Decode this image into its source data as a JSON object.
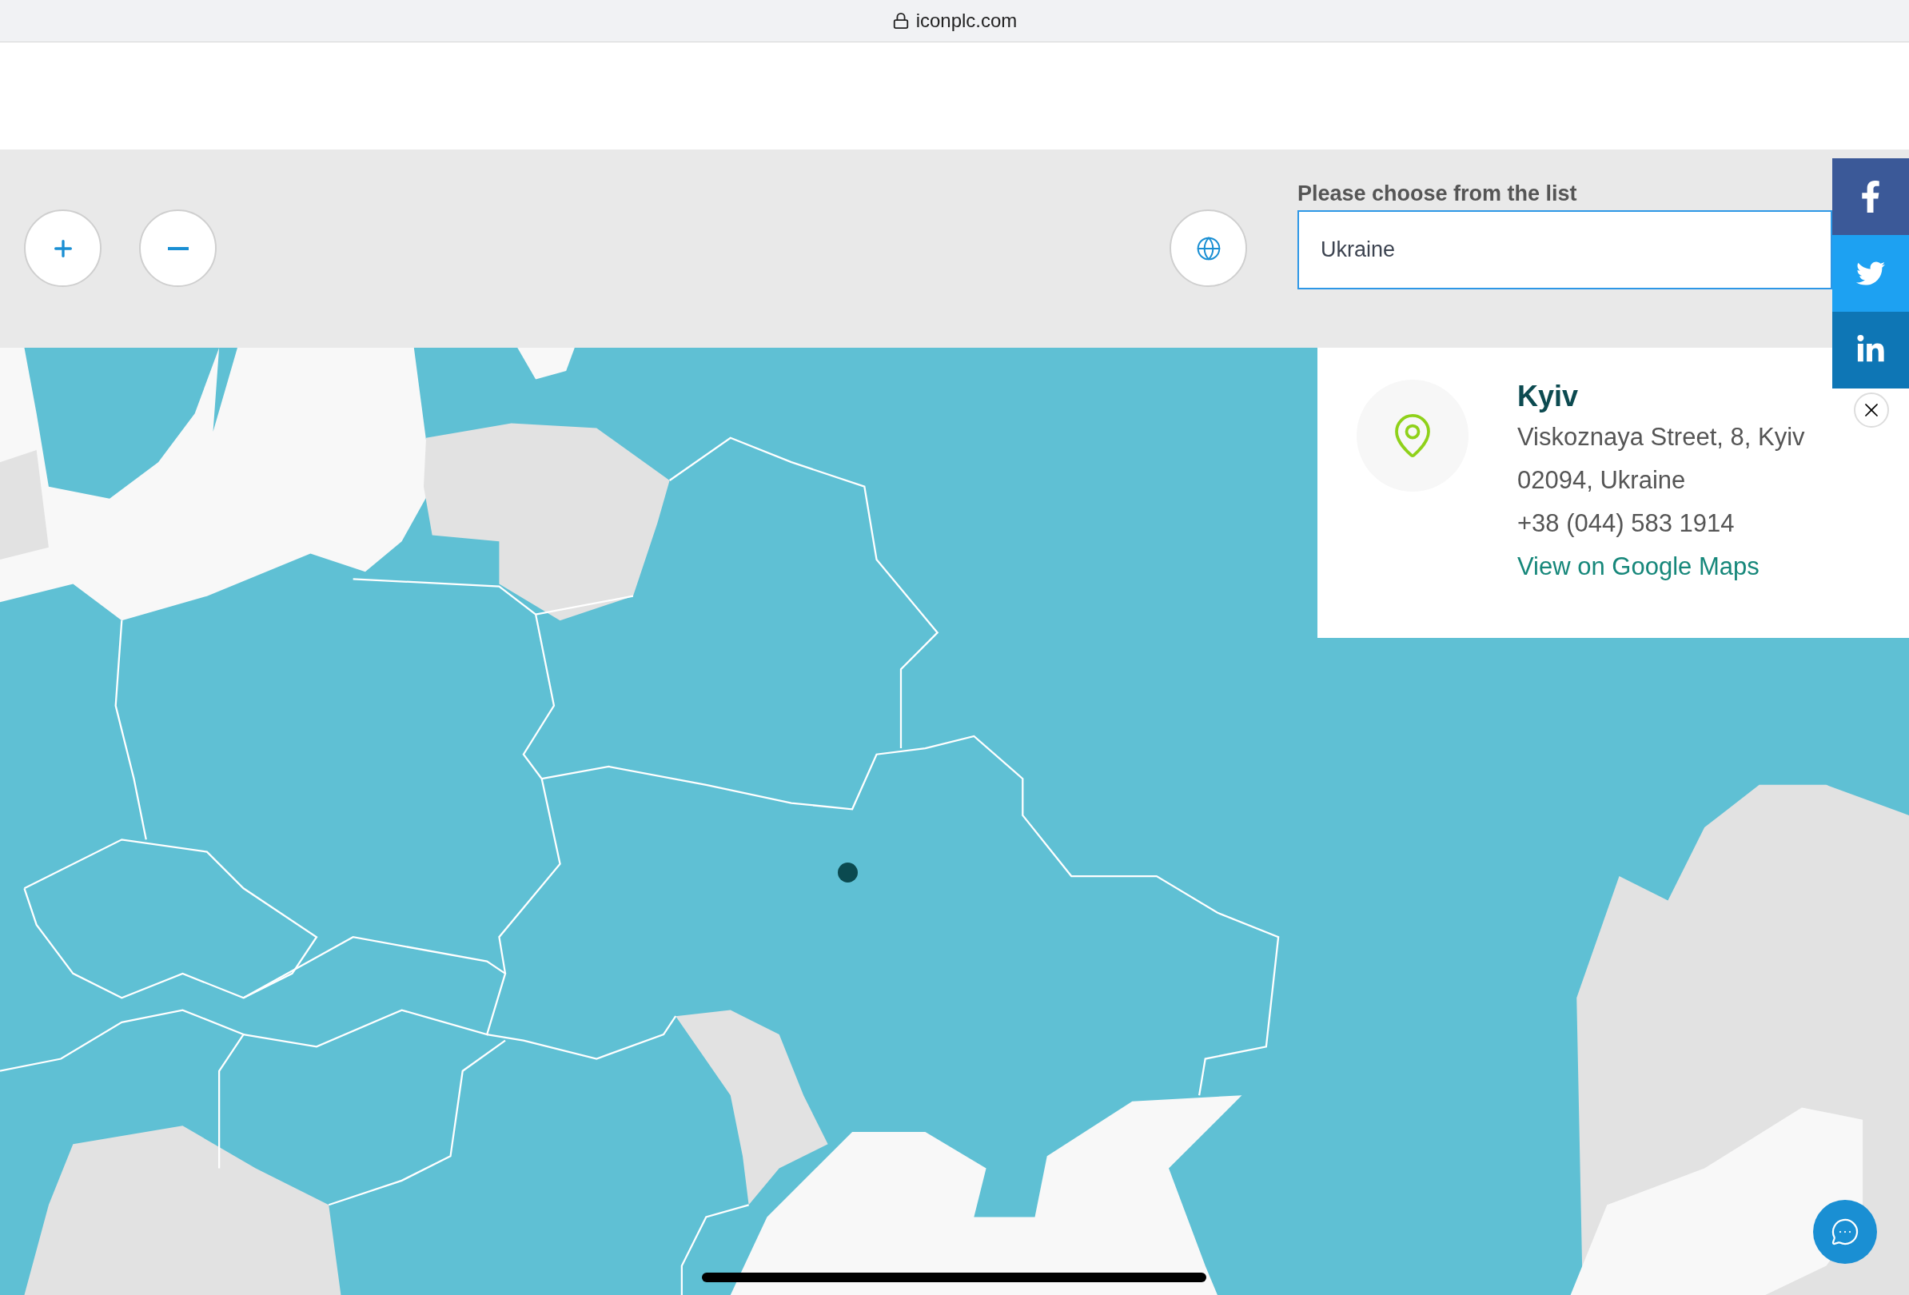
{
  "browser": {
    "url": "iconplc.com"
  },
  "selector": {
    "label": "Please choose from the list",
    "value": "Ukraine"
  },
  "office": {
    "name": "Kyiv",
    "address_lines": [
      "Viskoznaya Street, 8, Kyiv",
      "02094, Ukraine"
    ],
    "phone": "+38 (044) 583 1914",
    "link": "View on Google Maps"
  }
}
